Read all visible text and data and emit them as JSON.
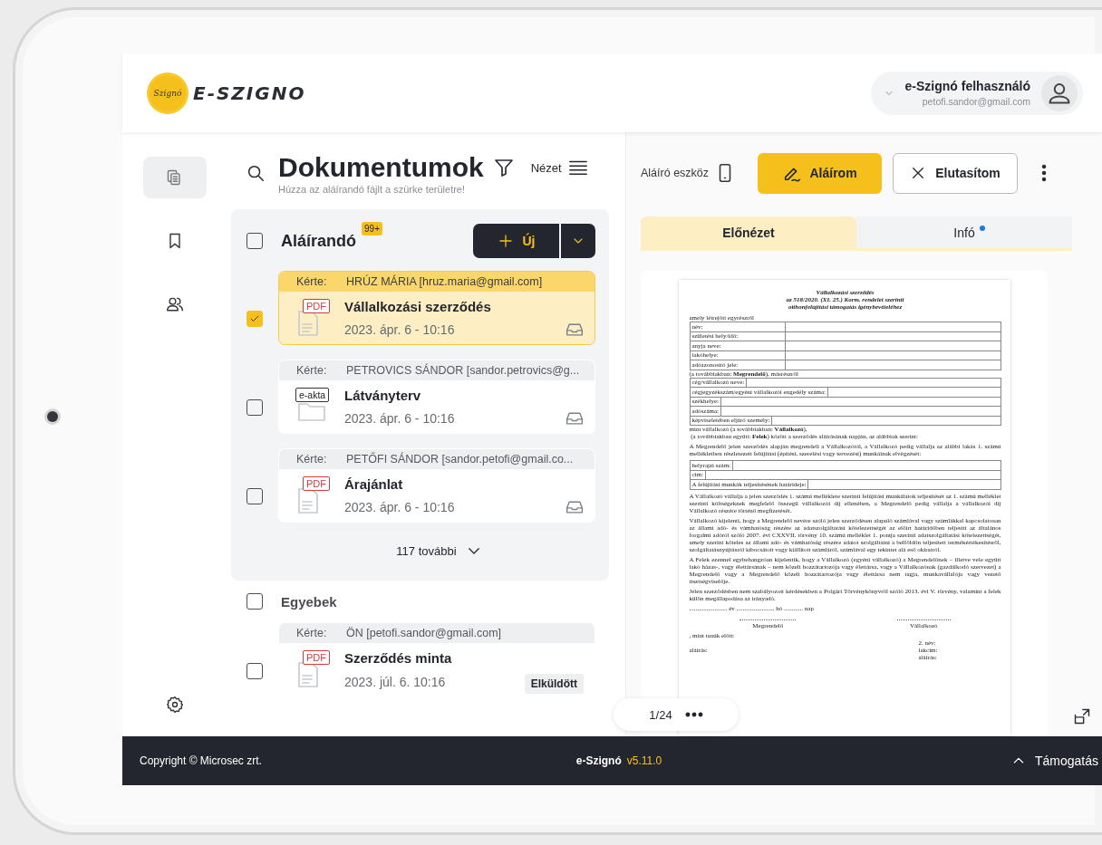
{
  "header": {
    "logo_badge": "Szignó",
    "logo_text": "E-SZIGNO",
    "user": {
      "name": "e-Szignó felhasználó",
      "email": "petofi.sandor@gmail.com"
    }
  },
  "sidebar": {
    "items": [
      {
        "kind": "documents",
        "selected": true
      },
      {
        "kind": "bookmark",
        "selected": false
      },
      {
        "kind": "users",
        "selected": false
      }
    ]
  },
  "documents": {
    "title": "Dokumentumok",
    "subtitle": "Húzza az aláírandó fájlt a szürke területre!",
    "view_label": "Nézet",
    "groups": [
      {
        "kind": "panel",
        "title": "Aláírandó",
        "badge": "99+",
        "checked": false,
        "new_button": "Új",
        "more": "117 további",
        "items": [
          {
            "requester_label": "Kérte:",
            "requester": "HRÚZ MÁRIA [hruz.maria@gmail.com]",
            "file": {
              "kind": "document",
              "label": "PDF"
            },
            "title": "Vállalkozási szerződés",
            "date": "2023. ápr. 6 - 10:16",
            "kind": "inbox",
            "checked": true,
            "selected": true
          },
          {
            "requester_label": "Kérte:",
            "requester": "PETROVICS SÁNDOR [sandor.petrovics@g...",
            "file": {
              "kind": "folder",
              "label": "e-akta"
            },
            "title": "Látványterv",
            "date": "2023. ápr. 6 - 10:16",
            "kind": "inbox",
            "checked": false,
            "selected": false
          },
          {
            "requester_label": "Kérte:",
            "requester": "PETŐFI SÁNDOR [sandor.petofi@gmail.co...",
            "file": {
              "kind": "document",
              "label": "PDF"
            },
            "title": "Árajánlat",
            "date": "2023. ápr. 6 - 10:16",
            "kind": "inbox",
            "checked": false,
            "selected": false
          }
        ]
      },
      {
        "kind": "plain",
        "title": "Egyebek",
        "checked": false,
        "items": [
          {
            "requester_label": "Kérte:",
            "requester": "ÖN [petofi.sandor@gmail.com]",
            "file": {
              "kind": "document",
              "label": "PDF"
            },
            "title": "Szerződés minta",
            "date": "2023. júl. 6. 10:16",
            "kind": "sent",
            "status": "Elküldött",
            "checked": false,
            "selected": false
          }
        ]
      }
    ]
  },
  "signing": {
    "device_label": "Aláíró eszköz",
    "sign_button": "Aláírom",
    "reject_button": "Elutasítom"
  },
  "tabs": [
    {
      "label": "Előnézet",
      "selected": true,
      "dot": false
    },
    {
      "label": "Infó",
      "selected": false,
      "dot": true
    }
  ],
  "preview": {
    "page": "1/24",
    "document": {
      "title_lines": [
        "Vállalkozási szerződés",
        "az 518/2020. (XI. 25.) Korm. rendelet szerinti",
        "otthonfelújítási támogatás igénybevételéhez"
      ],
      "blocks": [
        {
          "kind": "text",
          "text": "amely létrejött egyrészről"
        },
        {
          "kind": "fixed_table",
          "rows": [
            "név:",
            "születési hely/idő:",
            "anyja neve:",
            "lakóhelye:",
            "adóazonosító jele:"
          ]
        },
        {
          "kind": "text",
          "text": "(a továbbiakban: **Megrendelő**), másrészről"
        },
        {
          "kind": "table",
          "rows": [
            "cég/vállalkozó neve:",
            "cégjegyzékszám/egyéni vállalkozói engedély száma:",
            "székhelye:",
            "adószáma:",
            "képviseletében eljáró személy:"
          ]
        },
        {
          "kind": "text",
          "text": "mint vállalkozó (a továbbiakban: **Vállalkozó**),"
        },
        {
          "kind": "text",
          "text": " (a továbbiakban együtt: **Felek**) között a szerződés aláírásának napján, az alábbiak szerint:"
        },
        {
          "kind": "paragraph",
          "text": "A Megrendelő jelen szerződés alapján megrendeli a Vállalkozótól, a Vállalkozó pedig vállalja az alábbi lakás 1. számú mellékletben részletezett felújítási (építési, szerelési vagy tervezési) munkáinak elvégzését:"
        },
        {
          "kind": "table",
          "rows": [
            "helyrajzi szám:",
            "cím:",
            "A felújítási munkák teljesítésének határideje:"
          ]
        },
        {
          "kind": "paragraph",
          "text": "A Vállalkozó vállalja a jelen szerződés 1. számú melléklete szerinti felújítási munkálatok teljesítését az 1. számú melléklet szerinti költségeknek megfelelő összegű vállalkozói díj ellenében, a Megrendelő pedig vállalja a vállalkozói díj Vállalkozó részére történő megfizetését."
        },
        {
          "kind": "paragraph",
          "text": "Vállalkozó kijelenti, hogy a Megrendelő nevére szóló jelen szerződésen alapuló számlával vagy számlákkal kapcsolatosan az állami adó- és vámhatóság részére az adatszolgáltatási kötelezettségét az előírt határidőben teljesíti az általános forgalmi adóról szóló 2007. évi CXXVII. törvény 10. számú melléklet 1. pontja szerinti adatszolgáltatási kötelezettségét, amely szerint köteles az állami adó- és vámhatóság részére adatot szolgáltatni a belföldön teljesített termékértékesítésről, szolgáltatásnyújtásról kibocsátott vagy kiállított számláról, számlával egy tekintet alá eső okiratról."
        },
        {
          "kind": "paragraph",
          "text": "A Felek ezennel egybehangzóan kijelentik, hogy a Vállalkozó (egyéni vállalkozó) a Megrendelőnek – illetve vele együtt lakó házas-, vagy élettársának – nem közeli hozzátartozója vagy élettársa, vagy a Vállalkozónak (gazdálkodó szervezet) a Megrendelő vagy a Megrendelő közeli hozzátartozója vagy élettársa nem tagja, munkavállalója vagy vezető tisztségviselője."
        },
        {
          "kind": "paragraph",
          "text": "Jelen szerződésben nem szabályozott kérdésekben a Polgári Törvénykönyvről szóló 2013. évi V. törvény, valamint a felek külön megállapodása az irányadó."
        },
        {
          "kind": "text",
          "text": "........................ év ........................ hó ............ nap"
        },
        {
          "kind": "signatures",
          "left": "Megrendelő",
          "right": "Vállalkozó"
        },
        {
          "kind": "text",
          "text": ", mint tanúk előtt:"
        },
        {
          "kind": "witnesses",
          "left": [
            "aláírás:"
          ],
          "right": [
            "2. név:",
            "lakcím:",
            "aláírás:"
          ]
        }
      ]
    }
  },
  "footer": {
    "copyright": "Copyright © Microsec zrt.",
    "app_name": "e-Szignó",
    "version": "v5.11.0",
    "support": "Támogatás"
  }
}
